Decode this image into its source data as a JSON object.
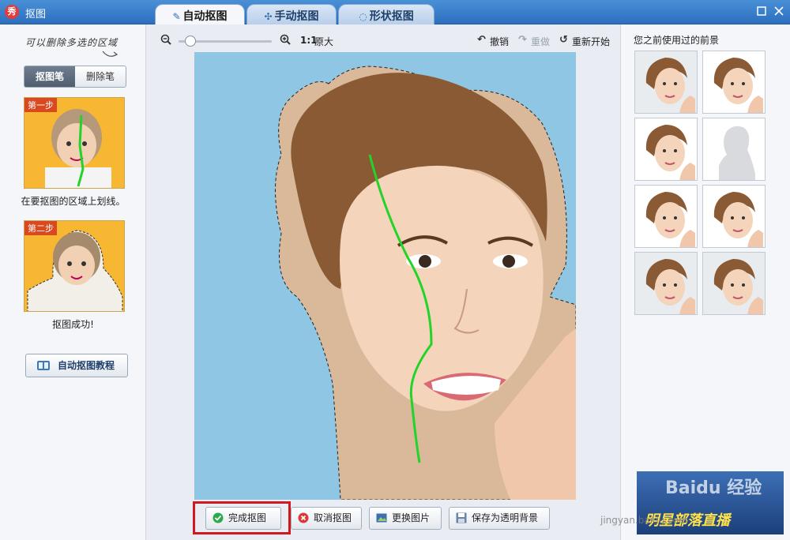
{
  "window": {
    "title": "抠图",
    "app_logo_text": "秀",
    "tabs": [
      {
        "label": "自动抠图",
        "active": true
      },
      {
        "label": "手动抠图",
        "active": false
      },
      {
        "label": "形状抠图",
        "active": false
      }
    ]
  },
  "left_panel": {
    "hint": "可以删除多选的区域",
    "pen_tabs": [
      "抠图笔",
      "删除笔"
    ],
    "steps": [
      {
        "badge": "第一步",
        "caption": "在要抠图的区域上划线。"
      },
      {
        "badge": "第二步",
        "caption": "抠图成功!"
      }
    ],
    "tutorial_button": "自动抠图教程"
  },
  "toolbar": {
    "ratio": "1:1",
    "ratio_label": "原大",
    "undo": "撤销",
    "redo": "重做",
    "restart": "重新开始",
    "zoom_level": 0.1
  },
  "bottom_buttons": {
    "finish": "完成抠图",
    "cancel": "取消抠图",
    "replace": "更换图片",
    "save": "保存为透明背景"
  },
  "right_panel": {
    "title": "您之前使用过的前景"
  },
  "watermark": {
    "brand": "Baidu 经验",
    "url": "jingyan.baidu.com",
    "banner": "明星部落直播"
  },
  "colors": {
    "accent": "#2c6fbf",
    "canvas_bg": "#8fc6e3",
    "stroke": "#22d42a",
    "highlight": "#d0181f"
  }
}
